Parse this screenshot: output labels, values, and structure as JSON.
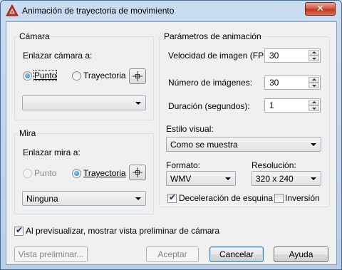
{
  "window": {
    "title": "Animación de trayectoria de movimiento",
    "close_glyph": "✕",
    "accent": "#c2351e"
  },
  "camera": {
    "legend": "Cámara",
    "link_label": "Enlazar cámara a:",
    "radio_point": "Punto",
    "radio_path": "Trayectoria",
    "selected": "Punto",
    "pick_icon": "pick-point-icon",
    "dropdown_value": ""
  },
  "target": {
    "legend": "Mira",
    "link_label": "Enlazar mira a:",
    "radio_point": "Punto",
    "radio_path": "Trayectoria",
    "selected": "Trayectoria",
    "pick_icon": "pick-point-icon",
    "dropdown_value": "Ninguna"
  },
  "animation": {
    "legend": "Parámetros de animación",
    "fps_label": "Velocidad de imagen (FPS):",
    "fps_value": "30",
    "frames_label": "Número de imágenes:",
    "frames_value": "30",
    "duration_label": "Duración (segundos):",
    "duration_value": "1",
    "visual_style_label": "Estilo visual:",
    "visual_style_value": "Como se muestra",
    "format_label": "Formato:",
    "format_value": "WMV",
    "resolution_label": "Resolución:",
    "resolution_value": "320 x 240",
    "corner_decel_label": "Deceleración de esquina",
    "corner_decel_checked": true,
    "reverse_label": "Inversión",
    "reverse_checked": false
  },
  "preview_option": {
    "label": "Al previsualizar, mostrar vista preliminar de cámara",
    "checked": true
  },
  "buttons": {
    "preview": "Vista preliminar...",
    "ok": "Aceptar",
    "cancel": "Cancelar",
    "help": "Ayuda"
  }
}
